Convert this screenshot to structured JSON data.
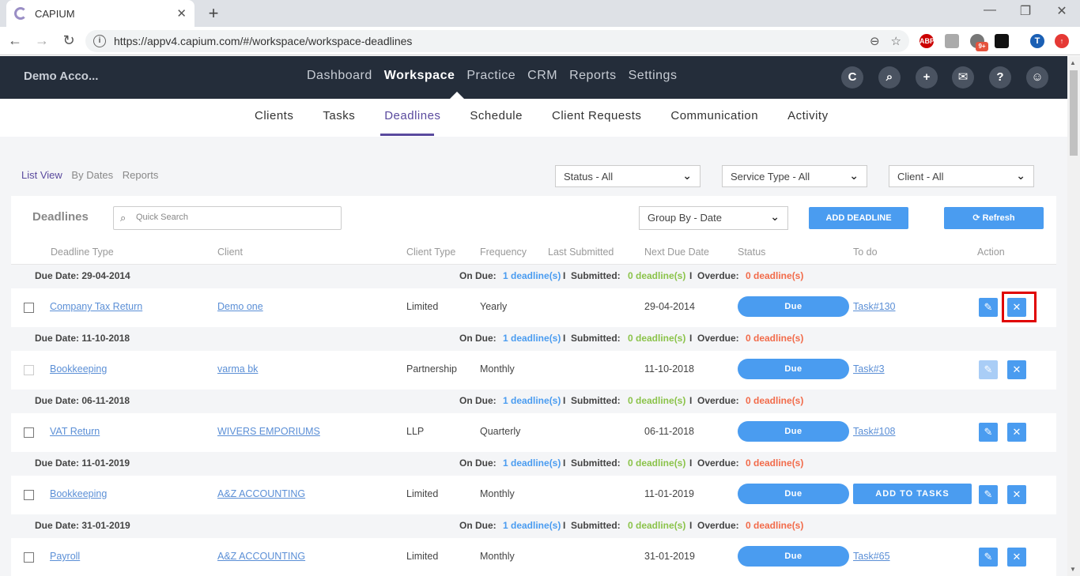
{
  "browser": {
    "tab_title": "CAPIUM",
    "tab_close": "✕",
    "new_tab": "+",
    "url": "https://appv4.capium.com/#/workspace/workspace-deadlines",
    "window_controls": [
      "—",
      "❐",
      "✕"
    ],
    "ext_abp": "ABP",
    "ext_badge": "9+",
    "profile_initial": "T"
  },
  "app": {
    "account_name": "Demo Acco...",
    "main_nav": [
      "Dashboard",
      "Workspace",
      "Practice",
      "CRM",
      "Reports",
      "Settings"
    ],
    "active_main": "Workspace",
    "sub_nav": [
      "Clients",
      "Tasks",
      "Deadlines",
      "Schedule",
      "Client Requests",
      "Communication",
      "Activity"
    ],
    "active_sub": "Deadlines",
    "header_icons": [
      "capium-logo-icon",
      "search-icon",
      "plus-icon",
      "mail-icon",
      "help-icon",
      "user-icon"
    ]
  },
  "views": [
    "List View",
    "By Dates",
    "Reports"
  ],
  "filters": {
    "status": "Status - All",
    "service_type": "Service Type - All",
    "client": "Client - All",
    "group_by": "Group By - Date"
  },
  "panel": {
    "title": "Deadlines",
    "search_placeholder": "Quick Search",
    "add_button": "ADD DEADLINE",
    "refresh_button": "Refresh"
  },
  "columns": [
    "Deadline Type",
    "Client",
    "Client Type",
    "Frequency",
    "Last Submitted",
    "Next Due Date",
    "Status",
    "To do",
    "Action"
  ],
  "summary_labels": {
    "on_due": "On Due:",
    "submitted": "Submitted:",
    "overdue": "Overdue:",
    "separator": "I"
  },
  "groups": [
    {
      "due_date": "Due Date: 29-04-2014",
      "on_due": "1 deadline(s)",
      "submitted": "0 deadline(s)",
      "overdue": "0 deadline(s)",
      "row": {
        "type": "Company Tax Return",
        "client": "Demo one",
        "client_type": "Limited",
        "frequency": "Yearly",
        "last_submitted": "",
        "next_due": "29-04-2014",
        "status": "Due",
        "todo": "Task#130"
      }
    },
    {
      "due_date": "Due Date: 11-10-2018",
      "on_due": "1 deadline(s)",
      "submitted": "0 deadline(s)",
      "overdue": "0 deadline(s)",
      "row": {
        "type": "Bookkeeping",
        "client": "varma bk",
        "client_type": "Partnership",
        "frequency": "Monthly",
        "last_submitted": "",
        "next_due": "11-10-2018",
        "status": "Due",
        "todo": "Task#3"
      }
    },
    {
      "due_date": "Due Date: 06-11-2018",
      "on_due": "1 deadline(s)",
      "submitted": "0 deadline(s)",
      "overdue": "0 deadline(s)",
      "row": {
        "type": "VAT Return",
        "client": "WIVERS EMPORIUMS",
        "client_type": "LLP",
        "frequency": "Quarterly",
        "last_submitted": "",
        "next_due": "06-11-2018",
        "status": "Due",
        "todo": "Task#108"
      }
    },
    {
      "due_date": "Due Date: 11-01-2019",
      "on_due": "1 deadline(s)",
      "submitted": "0 deadline(s)",
      "overdue": "0 deadline(s)",
      "row": {
        "type": "Bookkeeping",
        "client": "A&Z ACCOUNTING",
        "client_type": "Limited",
        "frequency": "Monthly",
        "last_submitted": "",
        "next_due": "11-01-2019",
        "status": "Due",
        "todo_button": "ADD TO TASKS"
      }
    },
    {
      "due_date": "Due Date: 31-01-2019",
      "on_due": "1 deadline(s)",
      "submitted": "0 deadline(s)",
      "overdue": "0 deadline(s)",
      "row": {
        "type": "Payroll",
        "client": "A&Z ACCOUNTING",
        "client_type": "Limited",
        "frequency": "Monthly",
        "last_submitted": "",
        "next_due": "31-01-2019",
        "status": "Due",
        "todo": "Task#65"
      }
    }
  ],
  "colors": {
    "on_due": "#4a9cf0",
    "submitted": "#8bc34a",
    "overdue": "#f26b4a",
    "accent": "#5a4a9e",
    "header_bg": "#242d3a",
    "button_blue": "#4a9cf0",
    "highlight": "#e00000"
  }
}
